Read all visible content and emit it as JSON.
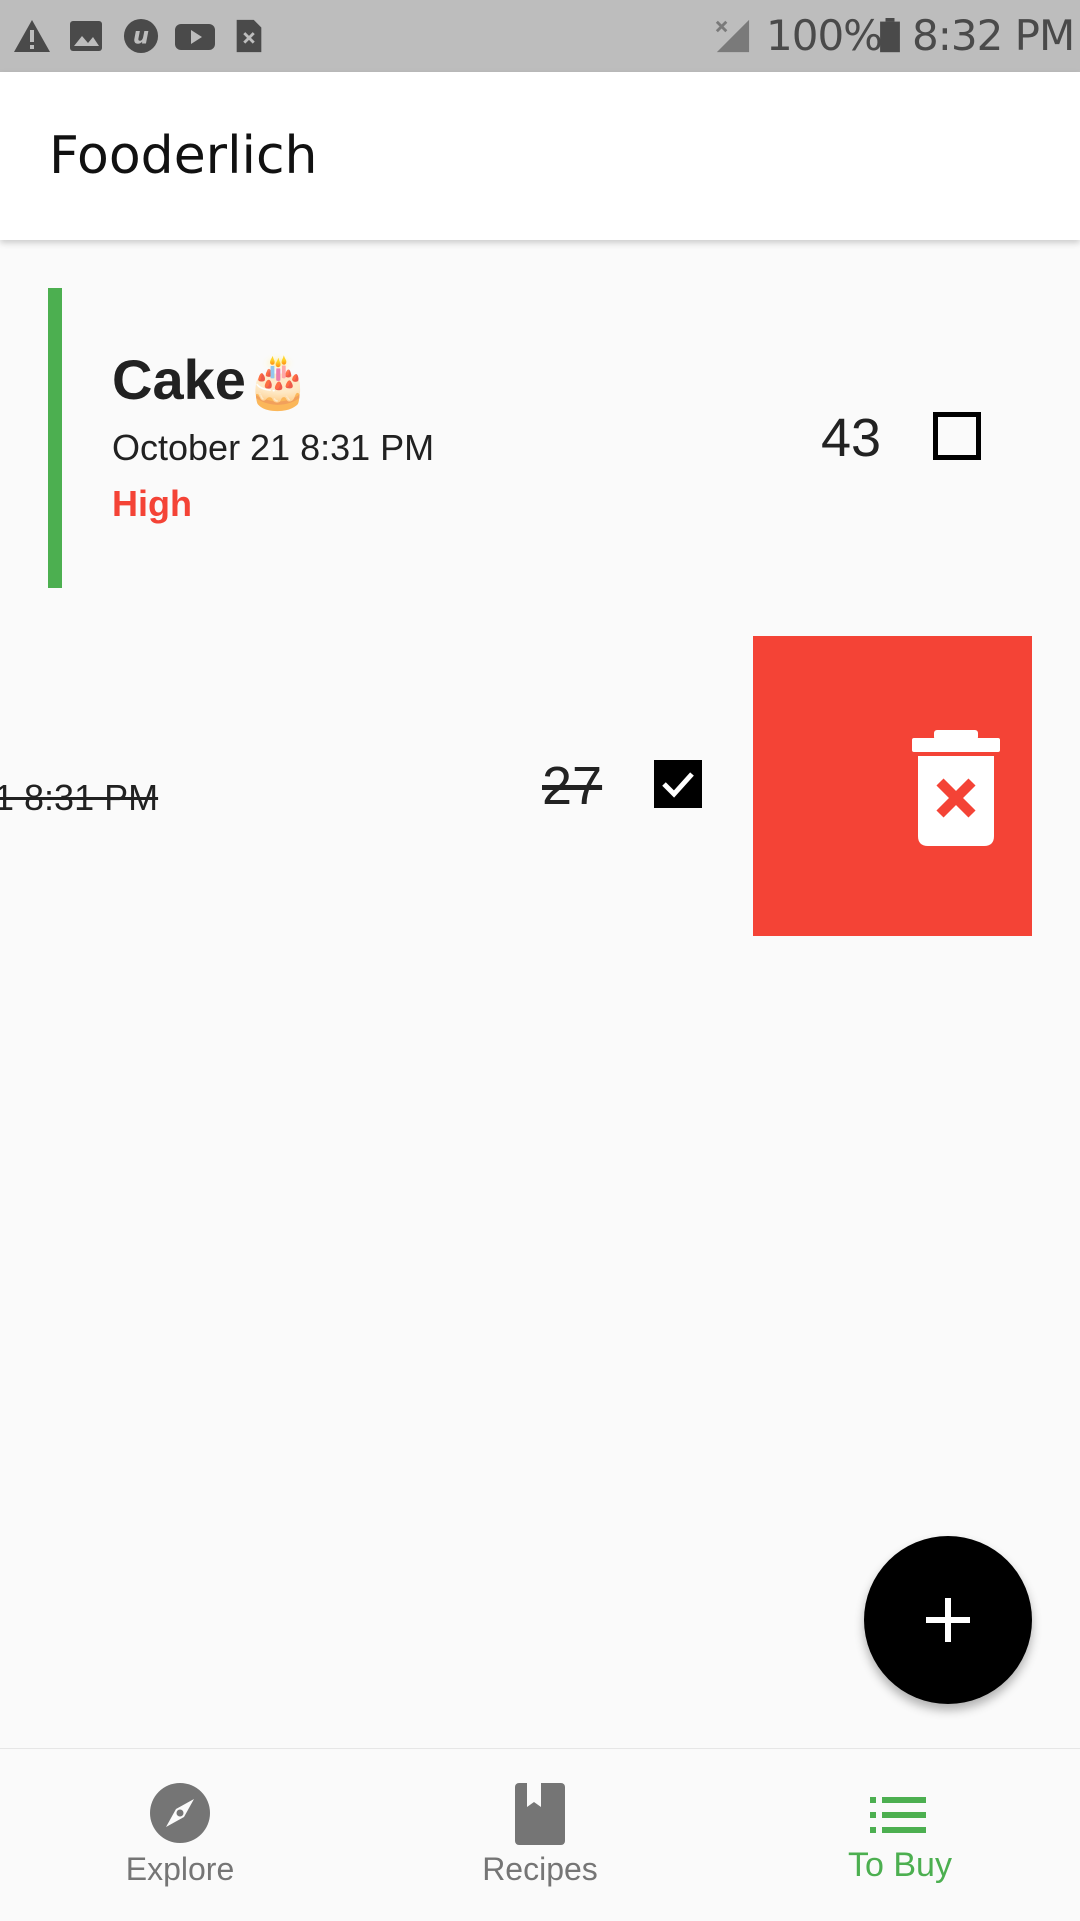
{
  "status_bar": {
    "battery_percent": "100%",
    "time": "8:32 PM",
    "left_icons": [
      "warning-icon",
      "image-icon",
      "upwork-icon",
      "youtube-icon",
      "sim-card-icon"
    ],
    "right_icons": [
      "no-signal-icon",
      "battery-icon"
    ]
  },
  "app_bar": {
    "title": "Fooderlich"
  },
  "items": [
    {
      "name": "Cake",
      "emoji": "🎂",
      "date": "October 21 8:31 PM",
      "importance": "High",
      "quantity": "43",
      "checked": false,
      "priority_color": "#4caf50",
      "importance_color": "#f44336"
    },
    {
      "date_partial": "1 8:31 PM",
      "quantity": "27",
      "checked": true,
      "swipe_action": "delete-forever-icon",
      "swipe_background": "#f44336"
    }
  ],
  "fab": {
    "icon": "add-icon"
  },
  "bottom_nav": {
    "active_color": "#4caf50",
    "inactive_color": "#757575",
    "items": [
      {
        "label": "Explore",
        "icon": "explore-icon",
        "active": false
      },
      {
        "label": "Recipes",
        "icon": "book-icon",
        "active": false
      },
      {
        "label": "To Buy",
        "icon": "list-icon",
        "active": true
      }
    ]
  }
}
